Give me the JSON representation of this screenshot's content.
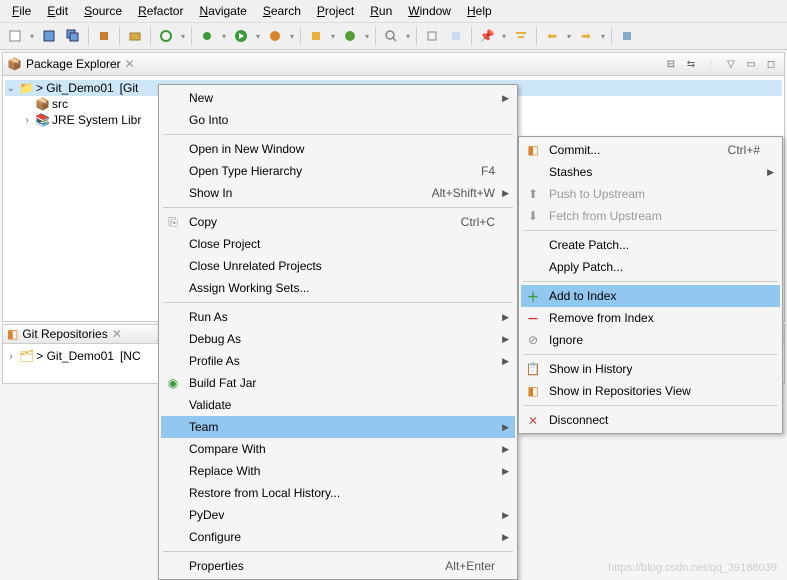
{
  "menubar": [
    "File",
    "Edit",
    "Source",
    "Refactor",
    "Navigate",
    "Search",
    "Project",
    "Run",
    "Window",
    "Help"
  ],
  "panels": {
    "explorer": {
      "title": "Package Explorer",
      "project": "Git_Demo01",
      "project_suffix": "[Git",
      "src": "src",
      "jre": "JRE System Libr"
    },
    "git": {
      "title": "Git Repositories",
      "repo": "Git_Demo01",
      "repo_suffix": "[NC"
    }
  },
  "context1": {
    "new": "New",
    "go_into": "Go Into",
    "open_new_window": "Open in New Window",
    "open_type_hierarchy": "Open Type Hierarchy",
    "open_type_hierarchy_sc": "F4",
    "show_in": "Show In",
    "show_in_sc": "Alt+Shift+W",
    "copy": "Copy",
    "copy_sc": "Ctrl+C",
    "close_project": "Close Project",
    "close_unrelated": "Close Unrelated Projects",
    "assign_ws": "Assign Working Sets...",
    "run_as": "Run As",
    "debug_as": "Debug As",
    "profile_as": "Profile As",
    "build_fat_jar": "Build Fat Jar",
    "validate": "Validate",
    "team": "Team",
    "compare_with": "Compare With",
    "replace_with": "Replace With",
    "restore_history": "Restore from Local History...",
    "pydev": "PyDev",
    "configure": "Configure",
    "properties": "Properties",
    "properties_sc": "Alt+Enter"
  },
  "context2": {
    "commit": "Commit...",
    "commit_sc": "Ctrl+#",
    "stashes": "Stashes",
    "push_upstream": "Push to Upstream",
    "fetch_upstream": "Fetch from Upstream",
    "create_patch": "Create Patch...",
    "apply_patch": "Apply Patch...",
    "add_to_index": "Add to Index",
    "remove_from_index": "Remove from Index",
    "ignore": "Ignore",
    "show_history": "Show in History",
    "show_repo_view": "Show in Repositories View",
    "disconnect": "Disconnect"
  },
  "watermark": "https://blog.csdn.net/qq_39188039"
}
